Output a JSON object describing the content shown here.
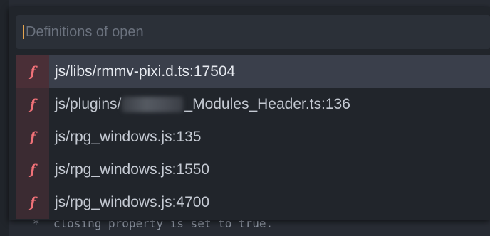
{
  "search": {
    "placeholder": "Definitions of open",
    "value": ""
  },
  "editor": {
    "background_line": "* _closing property is set to true."
  },
  "results": [
    {
      "badge": "f",
      "text": "js/libs/rmmv-pixi.d.ts:17504",
      "selected": true
    },
    {
      "badge": "f",
      "prefix": "js/plugins/",
      "suffix": "_Modules_Header.ts:136",
      "selected": false
    },
    {
      "badge": "f",
      "text": "js/rpg_windows.js:135",
      "selected": false
    },
    {
      "badge": "f",
      "text": "js/rpg_windows.js:1550",
      "selected": false
    },
    {
      "badge": "f",
      "text": "js/rpg_windows.js:4700",
      "selected": false
    }
  ],
  "colors": {
    "caret": "#e5a550",
    "function_badge": "#f07178",
    "selection": "#3a3f4b"
  }
}
